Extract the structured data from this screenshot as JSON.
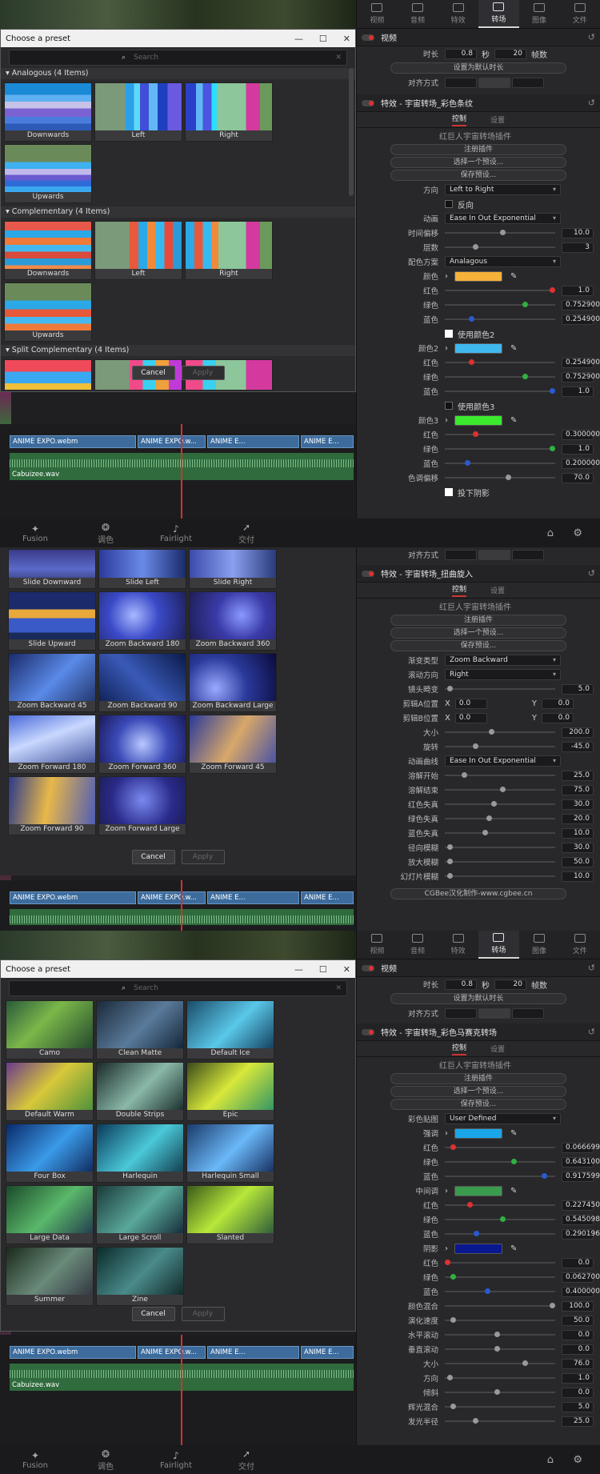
{
  "s1": {
    "tabs": [
      {
        "label": "视频",
        "icon": "video-icon"
      },
      {
        "label": "音频",
        "icon": "music-icon"
      },
      {
        "label": "特效",
        "icon": "fx-icon"
      },
      {
        "label": "转场",
        "icon": "transition-icon"
      },
      {
        "label": "图像",
        "icon": "image-icon"
      },
      {
        "label": "文件",
        "icon": "file-icon"
      }
    ],
    "video_header": "视频",
    "dur_label": "时长",
    "dur_sec": "0.8",
    "sec_unit": "秒",
    "dur_frames": "20",
    "frames_unit": "帧数",
    "set_default": "设置为默认时长",
    "align_label": "对齐方式",
    "fx_header": "特效 - 宇宙转场_彩色条纹",
    "ctrl_tab": "控制",
    "settings_tab": "设置",
    "plugin_name": "红巨人宇宙转场插件",
    "register": "注册插件",
    "choose_preset": "选择一个预设...",
    "save_preset": "保存预设...",
    "dir_label": "方向",
    "dir_val": "Left to Right",
    "reverse": "反向",
    "anim_label": "动画",
    "anim_val": "Ease In Out Exponential",
    "offset_label": "时间偏移",
    "offset_val": "10.0",
    "layers_label": "层数",
    "layers_val": "3",
    "scheme_label": "配色方案",
    "scheme_val": "Analagous",
    "c1_label": "颜色",
    "c1": "#f5b13a",
    "red": "红色",
    "green": "绿色",
    "blue": "蓝色",
    "c1r": "1.0",
    "c1g": "0.752900",
    "c1b": "0.254900",
    "use2": "使用颜色2",
    "c2_label": "颜色2",
    "c2": "#3fb8ee",
    "c2r": "0.254900",
    "c2g": "0.752900",
    "c2b": "1.0",
    "use3": "使用颜色3",
    "c3_label": "颜色3",
    "c3": "#3bea2d",
    "c3r": "0.300000",
    "c3g": "1.0",
    "c3b": "0.200000",
    "hue_label": "色调偏移",
    "hue_val": "70.0",
    "shadow": "投下阴影",
    "dialog_title": "Choose a preset",
    "search": "Search",
    "groups": [
      {
        "title": "Analogous (4 Items)",
        "items": [
          "Downwards",
          "Left",
          "Right",
          "Upwards"
        ]
      },
      {
        "title": "Complementary (4 Items)",
        "items": [
          "Downwards",
          "Left",
          "Right",
          "Upwards"
        ]
      },
      {
        "title": "Split Complementary (4 Items)",
        "items": [
          "",
          "",
          ""
        ]
      }
    ],
    "cancel": "Cancel",
    "apply": "Apply",
    "clips": [
      "ANIME EXPO.webm",
      "ANIME EXPO.w...",
      "ANIME E...",
      "ANIME E..."
    ],
    "audio": "Cabuizee.wav"
  },
  "s2": {
    "nav": [
      {
        "label": "Fusion",
        "icon": "fusion-icon"
      },
      {
        "label": "调色",
        "icon": "color-icon"
      },
      {
        "label": "Fairlight",
        "icon": "fairlight-icon"
      },
      {
        "label": "交付",
        "icon": "deliver-icon"
      }
    ],
    "align_label": "对齐方式",
    "fx_header": "特效 - 宇宙转场_扭曲旋入",
    "ctrl_tab": "控制",
    "settings_tab": "设置",
    "plugin_name": "红巨人宇宙转场插件",
    "register": "注册插件",
    "choose_preset": "选择一个预设...",
    "save_preset": "保存预设...",
    "type_label": "渐变类型",
    "type_val": "Zoom Backward",
    "move_label": "滚动方向",
    "move_val": "Right",
    "lens_label": "镜头畸变",
    "lens_val": "5.0",
    "cropA_label": "剪辑A位置",
    "cropB_label": "剪辑B位置",
    "x": "X",
    "y": "Y",
    "ax": "0.0",
    "ay": "0.0",
    "bx": "0.0",
    "by": "0.0",
    "size_label": "大小",
    "size_val": "200.0",
    "rot_label": "旋转",
    "rot_val": "-45.0",
    "anim_label": "动画曲线",
    "anim_val": "Ease In Out Exponential",
    "rows": [
      {
        "l": "溶解开始",
        "v": "25.0"
      },
      {
        "l": "溶解结束",
        "v": "75.0"
      },
      {
        "l": "红色失真",
        "v": "30.0"
      },
      {
        "l": "绿色失真",
        "v": "20.0"
      },
      {
        "l": "蓝色失真",
        "v": "10.0"
      },
      {
        "l": "径向模糊",
        "v": "30.0"
      },
      {
        "l": "放大模糊",
        "v": "50.0"
      },
      {
        "l": "幻灯片模糊",
        "v": "10.0"
      }
    ],
    "credit": "CGBee汉化制作-www.cgbee.cn",
    "thumbs": [
      "Slide Downward",
      "Slide Left",
      "Slide Right",
      "Slide Upward",
      "Zoom Backward 180",
      "Zoom Backward 360",
      "Zoom Backward 45",
      "Zoom Backward 90",
      "Zoom Backward Large",
      "Zoom Forward 180",
      "Zoom Forward 360",
      "Zoom Forward 45",
      "Zoom Forward 90",
      "Zoom Forward Large"
    ],
    "cancel": "Cancel",
    "apply": "Apply",
    "clips": [
      "ANIME EXPO.webm",
      "ANIME EXPO.w...",
      "ANIME E...",
      "ANIME E..."
    ]
  },
  "s3": {
    "tabs": [
      {
        "label": "视频",
        "icon": "video-icon"
      },
      {
        "label": "音频",
        "icon": "music-icon"
      },
      {
        "label": "特效",
        "icon": "fx-icon"
      },
      {
        "label": "转场",
        "icon": "transition-icon"
      },
      {
        "label": "图像",
        "icon": "image-icon"
      },
      {
        "label": "文件",
        "icon": "file-icon"
      }
    ],
    "video_header": "视频",
    "dur_label": "时长",
    "dur_sec": "0.8",
    "sec_unit": "秒",
    "dur_frames": "20",
    "frames_unit": "帧数",
    "set_default": "设置为默认时长",
    "align_label": "对齐方式",
    "fx_header": "特效 - 宇宙转场_彩色马赛克转场",
    "ctrl_tab": "控制",
    "settings_tab": "设置",
    "plugin_name": "红巨人宇宙转场插件",
    "register": "注册插件",
    "choose_preset": "选择一个预设...",
    "save_preset": "保存预设...",
    "map_label": "彩色贴图",
    "map_val": "User Defined",
    "hi_label": "强调",
    "hi": "#1aa6e8",
    "red": "红色",
    "green": "绿色",
    "blue": "蓝色",
    "hir": "0.066699",
    "hig": "0.643100",
    "hib": "0.917599",
    "mid_label": "中间调",
    "mid": "#3a9a4e",
    "midr": "0.227450",
    "midg": "0.545098",
    "midb": "0.290196",
    "sh_label": "阴影",
    "sh": "#0a1890",
    "shr": "0.0",
    "shg": "0.062700",
    "shb": "0.400000",
    "rows": [
      {
        "l": "颜色混合",
        "v": "100.0"
      },
      {
        "l": "演化速度",
        "v": "50.0"
      },
      {
        "l": "水平滚动",
        "v": "0.0"
      },
      {
        "l": "垂直滚动",
        "v": "0.0"
      },
      {
        "l": "大小",
        "v": "76.0"
      },
      {
        "l": "方向",
        "v": "1.0"
      },
      {
        "l": "倾斜",
        "v": "0.0"
      },
      {
        "l": "辉光混合",
        "v": "5.0"
      },
      {
        "l": "发光半径",
        "v": "25.0"
      }
    ],
    "dialog_title": "Choose a preset",
    "search": "Search",
    "thumbs": [
      "Camo",
      "Clean Matte",
      "Default Ice",
      "Default Warm",
      "Double Strips",
      "Epic",
      "Four Box",
      "Harlequin",
      "Harlequin Small",
      "Large Data",
      "Large Scroll",
      "Slanted",
      "Summer",
      "Zine"
    ],
    "cancel": "Cancel",
    "apply": "Apply",
    "clips": [
      "ANIME EXPO.webm",
      "ANIME EXPO.w...",
      "ANIME E...",
      "ANIME E..."
    ],
    "audio": "Cabuizee.wav",
    "nav": [
      {
        "label": "Fusion",
        "icon": "fusion-icon"
      },
      {
        "label": "调色",
        "icon": "color-icon"
      },
      {
        "label": "Fairlight",
        "icon": "fairlight-icon"
      },
      {
        "label": "交付",
        "icon": "deliver-icon"
      }
    ]
  }
}
